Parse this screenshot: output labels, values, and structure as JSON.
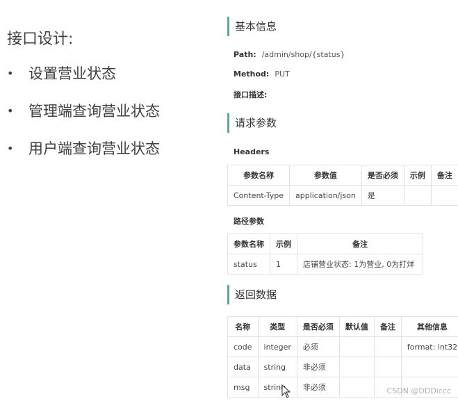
{
  "left": {
    "title": "接口设计:",
    "bullet": "•",
    "items": [
      "设置营业状态",
      "管理端查询营业状态",
      "用户端查询营业状态"
    ]
  },
  "basic": {
    "title": "基本信息",
    "path_label": "Path:",
    "path_value": "/admin/shop/{status}",
    "method_label": "Method:",
    "method_value": "PUT",
    "desc_label": "接口描述:"
  },
  "request": {
    "title": "请求参数",
    "headers_title": "Headers",
    "headers_columns": [
      "参数名称",
      "参数值",
      "是否必须",
      "示例",
      "备注"
    ],
    "headers_rows": [
      [
        "Content-Type",
        "application/json",
        "是",
        "",
        ""
      ]
    ],
    "path_title": "路径参数",
    "path_columns": [
      "参数名称",
      "示例",
      "备注"
    ],
    "path_rows": [
      [
        "status",
        "1",
        "店铺营业状态: 1为营业, 0为打烊"
      ]
    ]
  },
  "response": {
    "title": "返回数据",
    "columns": [
      "名称",
      "类型",
      "是否必须",
      "默认值",
      "备注",
      "其他信息"
    ],
    "rows": [
      [
        "code",
        "integer",
        "必须",
        "",
        "",
        "format: int32"
      ],
      [
        "data",
        "string",
        "非必须",
        "",
        "",
        ""
      ],
      [
        "msg",
        "string",
        "非必须",
        "",
        "",
        ""
      ]
    ]
  },
  "watermark": "CSDN @DDDiccc",
  "accent_color": "#42b983"
}
